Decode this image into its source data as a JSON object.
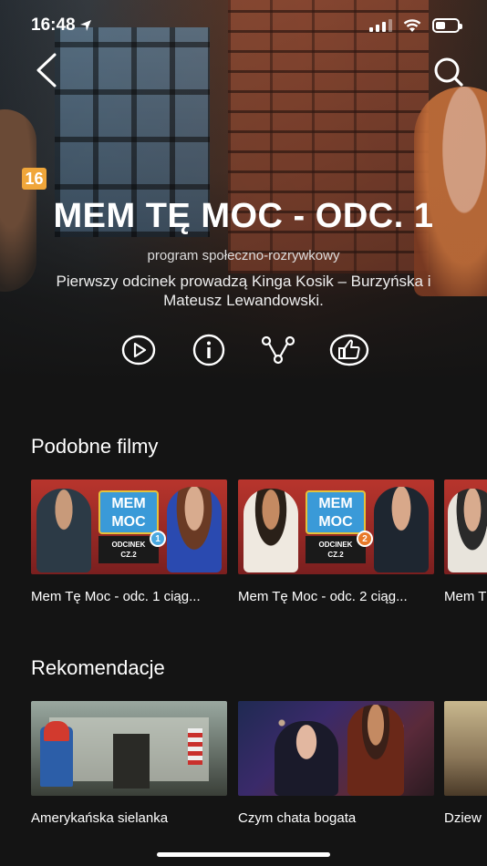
{
  "status_bar": {
    "time": "16:48",
    "location_icon": "location-arrow-icon",
    "signal_icon": "cellular-signal-icon",
    "wifi_icon": "wifi-icon",
    "battery_icon": "battery-icon"
  },
  "header": {
    "back_icon": "chevron-left-icon",
    "search_icon": "search-icon"
  },
  "hero": {
    "age_rating": "16",
    "title": "MEM TĘ MOC - ODC. 1",
    "genre": "program społeczno-rozrywkowy",
    "description": "Pierwszy odcinek prowadzą Kinga Kosik – Burzyńska i Mateusz Lewandowski.",
    "age_badge_color": "#f0a63a"
  },
  "actions": [
    {
      "icon": "play-icon"
    },
    {
      "icon": "info-icon"
    },
    {
      "icon": "share-icon"
    },
    {
      "icon": "thumbs-up-icon"
    }
  ],
  "similar": {
    "title": "Podobne filmy",
    "items": [
      {
        "label": "Mem Tę Moc - odc. 1 ciąg...",
        "logo": "MEM MOC",
        "ep_line1": "ODCINEK",
        "ep_line2": "CZ.2",
        "num": "1"
      },
      {
        "label": "Mem Tę Moc - odc. 2 ciąg...",
        "logo": "MEM MOC",
        "ep_line1": "ODCINEK",
        "ep_line2": "CZ.2",
        "num": "2"
      },
      {
        "label": "Mem T"
      }
    ]
  },
  "recommendations": {
    "title": "Rekomendacje",
    "items": [
      {
        "label": "Amerykańska sielanka"
      },
      {
        "label": "Czym chata bogata"
      },
      {
        "label": "Dziew"
      }
    ]
  }
}
